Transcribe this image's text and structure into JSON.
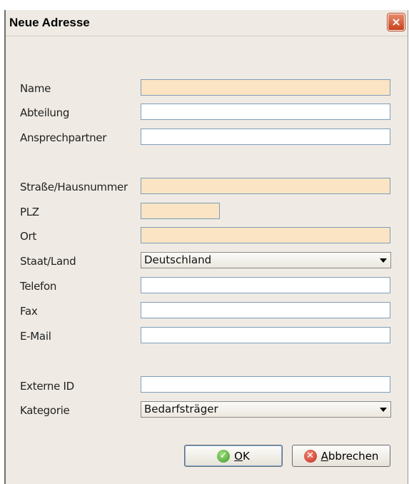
{
  "dialog": {
    "title": "Neue Adresse",
    "close_label": "×"
  },
  "form": {
    "name": {
      "label": "Name",
      "value": ""
    },
    "abteilung": {
      "label": "Abteilung",
      "value": ""
    },
    "ansprechpartner": {
      "label": "Ansprechpartner",
      "value": ""
    },
    "strasse": {
      "label": "Straße/Hausnummer",
      "value": ""
    },
    "plz": {
      "label": "PLZ",
      "value": ""
    },
    "ort": {
      "label": "Ort",
      "value": ""
    },
    "staat": {
      "label": "Staat/Land",
      "value": "Deutschland"
    },
    "telefon": {
      "label": "Telefon",
      "value": ""
    },
    "fax": {
      "label": "Fax",
      "value": ""
    },
    "email": {
      "label": "E-Mail",
      "value": ""
    },
    "externe_id": {
      "label": "Externe ID",
      "value": ""
    },
    "kategorie": {
      "label": "Kategorie",
      "value": "Bedarfsträger"
    }
  },
  "buttons": {
    "ok_first": "O",
    "ok_rest": "K",
    "cancel_first": "A",
    "cancel_rest": "bbrechen"
  },
  "colors": {
    "required_field": "#fbe4c3",
    "dialog_bg": "#efebe4",
    "close_red": "#c8421c"
  }
}
